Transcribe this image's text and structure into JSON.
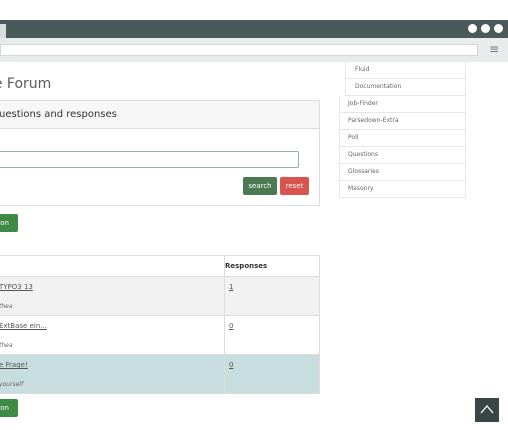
{
  "browser": {
    "menu_icon": "≡"
  },
  "page": {
    "title": "ase Forum"
  },
  "search_panel": {
    "title": "uestions and responses",
    "search_label": "search",
    "reset_label": "reset",
    "colors": {
      "search": "#4a7a52",
      "reset": "#d9534f"
    }
  },
  "top_button": {
    "label": "ion"
  },
  "bottom_button": {
    "label": "ion"
  },
  "table": {
    "header_responses": "Responses",
    "rows": [
      {
        "topic": "TYPO3 13",
        "author": "thea",
        "responses": "1"
      },
      {
        "topic": "ExtBase ein...",
        "author": "thea",
        "responses": "0"
      },
      {
        "topic": "e Frage!",
        "author": "yourself",
        "responses": "0"
      }
    ]
  },
  "sidebar": {
    "items": [
      {
        "label": "Fluid",
        "sub": true
      },
      {
        "label": "Documentation",
        "sub": true
      },
      {
        "label": "Job-Finder",
        "sub": false
      },
      {
        "label": "Parsedown-Extra",
        "sub": false
      },
      {
        "label": "Poll",
        "sub": false
      },
      {
        "label": "Questions",
        "sub": false
      },
      {
        "label": "Glossaries",
        "sub": false
      },
      {
        "label": "Masonry",
        "sub": false
      }
    ]
  }
}
